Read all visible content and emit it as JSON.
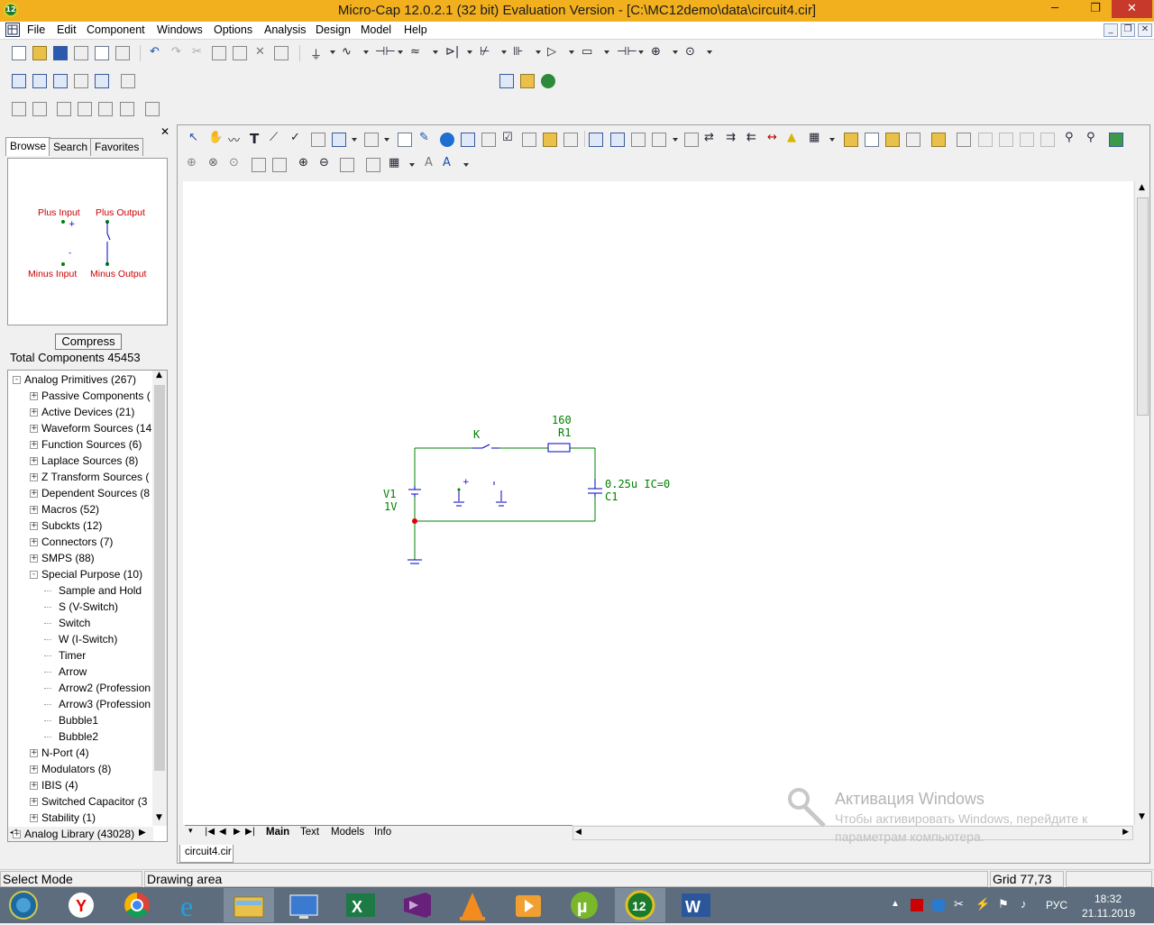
{
  "window": {
    "title": "Micro-Cap 12.0.2.1 (32 bit) Evaluation Version - [C:\\MC12demo\\data\\circuit4.cir]",
    "app_icon": "12"
  },
  "menu": [
    "File",
    "Edit",
    "Component",
    "Windows",
    "Options",
    "Analysis",
    "Design",
    "Model",
    "Help"
  ],
  "browser": {
    "tabs": [
      "Browse",
      "Search",
      "Favorites"
    ],
    "preview_labels": {
      "plus_input": "Plus Input",
      "plus_output": "Plus Output",
      "minus_input": "Minus Input",
      "minus_output": "Minus Output",
      "plus_sign": "+",
      "minus_sign": "-"
    },
    "compress_label": "Compress",
    "total": "Total Components 45453",
    "tree": [
      {
        "label": "Analog Primitives (267)",
        "level": 0,
        "exp": "-"
      },
      {
        "label": "Passive Components (",
        "level": 1,
        "exp": "+"
      },
      {
        "label": "Active Devices (21)",
        "level": 1,
        "exp": "+"
      },
      {
        "label": "Waveform Sources (14",
        "level": 1,
        "exp": "+"
      },
      {
        "label": "Function Sources (6)",
        "level": 1,
        "exp": "+"
      },
      {
        "label": "Laplace Sources (8)",
        "level": 1,
        "exp": "+"
      },
      {
        "label": "Z Transform Sources (",
        "level": 1,
        "exp": "+"
      },
      {
        "label": "Dependent Sources (8",
        "level": 1,
        "exp": "+"
      },
      {
        "label": "Macros (52)",
        "level": 1,
        "exp": "+"
      },
      {
        "label": "Subckts (12)",
        "level": 1,
        "exp": "+"
      },
      {
        "label": "Connectors (7)",
        "level": 1,
        "exp": "+"
      },
      {
        "label": "SMPS (88)",
        "level": 1,
        "exp": "+"
      },
      {
        "label": "Special Purpose (10)",
        "level": 1,
        "exp": "-"
      },
      {
        "label": "Sample and Hold",
        "level": 2,
        "exp": ""
      },
      {
        "label": "S (V-Switch)",
        "level": 2,
        "exp": ""
      },
      {
        "label": "Switch",
        "level": 2,
        "exp": ""
      },
      {
        "label": "W (I-Switch)",
        "level": 2,
        "exp": ""
      },
      {
        "label": "Timer",
        "level": 2,
        "exp": ""
      },
      {
        "label": "Arrow",
        "level": 2,
        "exp": ""
      },
      {
        "label": "Arrow2 (Profession",
        "level": 2,
        "exp": ""
      },
      {
        "label": "Arrow3 (Profession",
        "level": 2,
        "exp": ""
      },
      {
        "label": "Bubble1",
        "level": 2,
        "exp": ""
      },
      {
        "label": "Bubble2",
        "level": 2,
        "exp": ""
      },
      {
        "label": "N-Port (4)",
        "level": 1,
        "exp": "+"
      },
      {
        "label": "Modulators (8)",
        "level": 1,
        "exp": "+"
      },
      {
        "label": "IBIS (4)",
        "level": 1,
        "exp": "+"
      },
      {
        "label": "Switched Capacitor (3",
        "level": 1,
        "exp": "+"
      },
      {
        "label": "Stability (1)",
        "level": 1,
        "exp": "+"
      },
      {
        "label": "Analog Library (43028)",
        "level": 0,
        "exp": "+"
      }
    ]
  },
  "schematic": {
    "r1_value": "160",
    "r1_name": "R1",
    "switch_name": "K",
    "v1_name": "V1",
    "v1_value": "1V",
    "c1_value": "0.25u IC=0",
    "c1_name": "C1",
    "plus_sign": "+",
    "wire_color": "#008000",
    "component_color": "#0000c0"
  },
  "canvas_tabs": [
    "Main",
    "Text",
    "Models",
    "Info"
  ],
  "document_tab": "circuit4.cir",
  "status": {
    "mode": "Select Mode",
    "area": "Drawing area",
    "grid": "Grid 77,73"
  },
  "watermark": {
    "line1": "Активация Windows",
    "line2": "Чтобы активировать Windows, перейдите к",
    "line3": "параметрам компьютера."
  },
  "tray": {
    "lang": "РУС",
    "time": "18:32",
    "date": "21.11.2019"
  },
  "taskbar_icons": [
    "windows-start-icon",
    "yandex-browser-icon",
    "chrome-icon",
    "internet-explorer-icon",
    "file-explorer-icon",
    "remote-desktop-icon",
    "excel-icon",
    "visual-studio-icon",
    "vlc-icon",
    "video-player-icon",
    "utorrent-icon",
    "microcap-icon",
    "word-icon"
  ]
}
